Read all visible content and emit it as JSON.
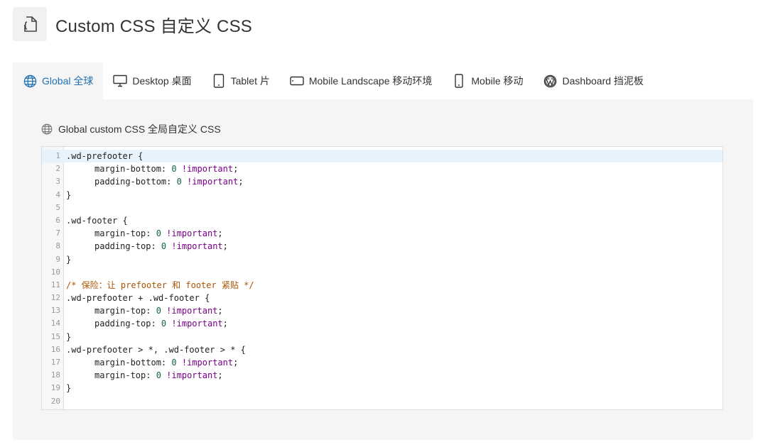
{
  "header": {
    "title": "Custom CSS  自定义 CSS",
    "icon": "file-code-icon"
  },
  "tabs": [
    {
      "label": "Global  全球",
      "icon": "globe-icon",
      "active": true
    },
    {
      "label": "Desktop  桌面",
      "icon": "monitor-icon"
    },
    {
      "label": "Tablet  片",
      "icon": "tablet-icon"
    },
    {
      "label": "Mobile Landscape  移动环境",
      "icon": "mobile-landscape-icon"
    },
    {
      "label": "Mobile  移动",
      "icon": "mobile-icon"
    },
    {
      "label": "Dashboard  挡泥板",
      "icon": "wordpress-icon"
    }
  ],
  "section": {
    "title": "Global custom CSS  全局自定义 CSS",
    "icon": "globe-icon"
  },
  "editor": {
    "line_numbers": [
      "1",
      "2",
      "3",
      "4",
      "5",
      "6",
      "7",
      "8",
      "9",
      "10",
      "11",
      "12",
      "13",
      "14",
      "15",
      "16",
      "17",
      "18",
      "19",
      "20"
    ],
    "lines": [
      {
        "text": ".wd-prefooter {"
      },
      {
        "indent": true,
        "prop": "margin-bottom: ",
        "val": "0",
        "kw": "!important",
        "end": ";"
      },
      {
        "indent": true,
        "prop": "padding-bottom: ",
        "val": "0",
        "kw": "!important",
        "end": ";"
      },
      {
        "text": "}"
      },
      {
        "text": ""
      },
      {
        "text": ".wd-footer {"
      },
      {
        "indent": true,
        "prop": "margin-top: ",
        "val": "0",
        "kw": "!important",
        "end": ";"
      },
      {
        "indent": true,
        "prop": "padding-top: ",
        "val": "0",
        "kw": "!important",
        "end": ";"
      },
      {
        "text": "}"
      },
      {
        "text": ""
      },
      {
        "comment": "/* 保险：让 prefooter 和 footer 紧贴 */"
      },
      {
        "text": ".wd-prefooter + .wd-footer {"
      },
      {
        "indent": true,
        "prop": "margin-top: ",
        "val": "0",
        "kw": "!important",
        "end": ";"
      },
      {
        "indent": true,
        "prop": "padding-top: ",
        "val": "0",
        "kw": "!important",
        "end": ";"
      },
      {
        "text": "}"
      },
      {
        "text": ".wd-prefooter > *, .wd-footer > * {"
      },
      {
        "indent": true,
        "prop": "margin-bottom: ",
        "val": "0",
        "kw": "!important",
        "end": ";"
      },
      {
        "indent": true,
        "prop": "margin-top: ",
        "val": "0",
        "kw": "!important",
        "end": ";"
      },
      {
        "text": "}"
      },
      {
        "text": ""
      }
    ],
    "current_line": 1
  },
  "colors": {
    "accent": "#2271b1",
    "panel": "#f5f5f5",
    "number": "#116644",
    "keyword": "#770088",
    "comment": "#aa5500"
  }
}
